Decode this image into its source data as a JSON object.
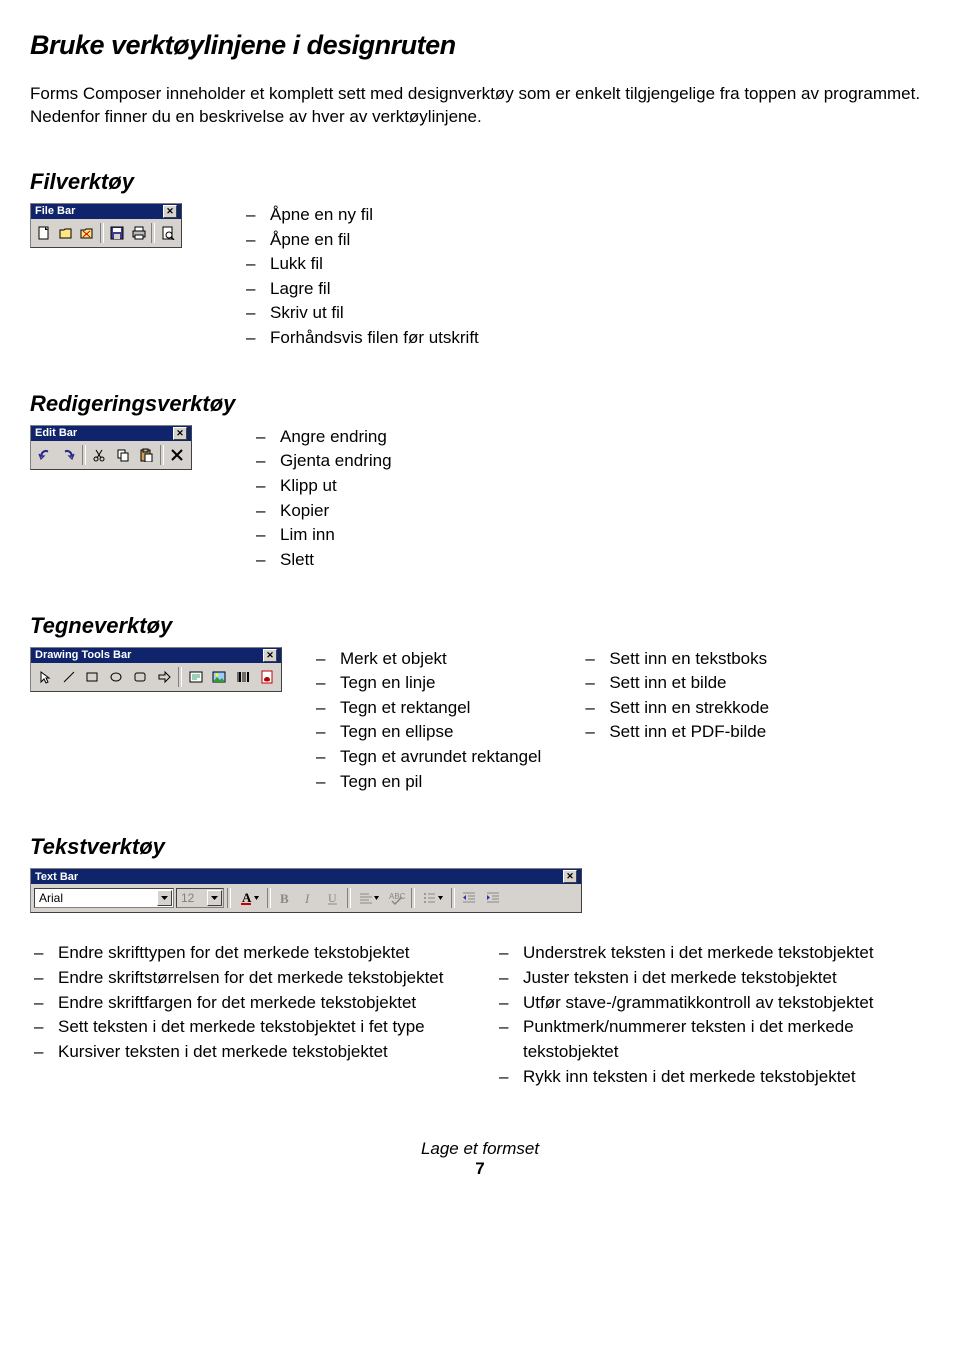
{
  "title": "Bruke verktøylinjene i designruten",
  "intro": "Forms Composer inneholder et komplett sett med designverktøy som er enkelt tilgjengelige fra toppen av programmet. Nedenfor finner du en beskrivelse av hver av verktøylinjene.",
  "file": {
    "heading": "Filverktøy",
    "toolbar_title": "File Bar",
    "items": [
      "Åpne en ny fil",
      "Åpne en fil",
      "Lukk fil",
      "Lagre fil",
      "Skriv ut fil",
      "Forhåndsvis filen før utskrift"
    ]
  },
  "edit": {
    "heading": "Redigeringsverktøy",
    "toolbar_title": "Edit Bar",
    "items": [
      "Angre endring",
      "Gjenta endring",
      "Klipp ut",
      "Kopier",
      "Lim inn",
      "Slett"
    ]
  },
  "draw": {
    "heading": "Tegneverktøy",
    "toolbar_title": "Drawing Tools Bar",
    "col1": [
      "Merk et objekt",
      "Tegn en linje",
      "Tegn et rektangel",
      "Tegn en ellipse",
      "Tegn et avrundet rektangel",
      "Tegn en pil"
    ],
    "col2": [
      "Sett inn en tekstboks",
      "Sett inn et bilde",
      "Sett inn en strekkode",
      "Sett inn et PDF-bilde"
    ]
  },
  "text": {
    "heading": "Tekstverktøy",
    "toolbar_title": "Text Bar",
    "font_value": "Arial",
    "size_value": "12",
    "col1": [
      "Endre skrifttypen for det merkede tekstobjektet",
      "Endre skriftstørrelsen for det merkede tekstobjektet",
      "Endre skriftfargen for det merkede tekstobjektet",
      "Sett teksten i det merkede tekstobjektet i fet type",
      "Kursiver teksten i det merkede tekstobjektet"
    ],
    "col2": [
      "Understrek teksten i det merkede tekstobjektet",
      "Juster teksten i det merkede tekstobjektet",
      "Utfør stave-/grammatikkontroll av tekstobjektet",
      "Punktmerk/nummerer teksten i det merkede tekstobjektet",
      "Rykk inn teksten i det merkede tekstobjektet"
    ]
  },
  "footer": {
    "label": "Lage et formset",
    "page": "7"
  }
}
